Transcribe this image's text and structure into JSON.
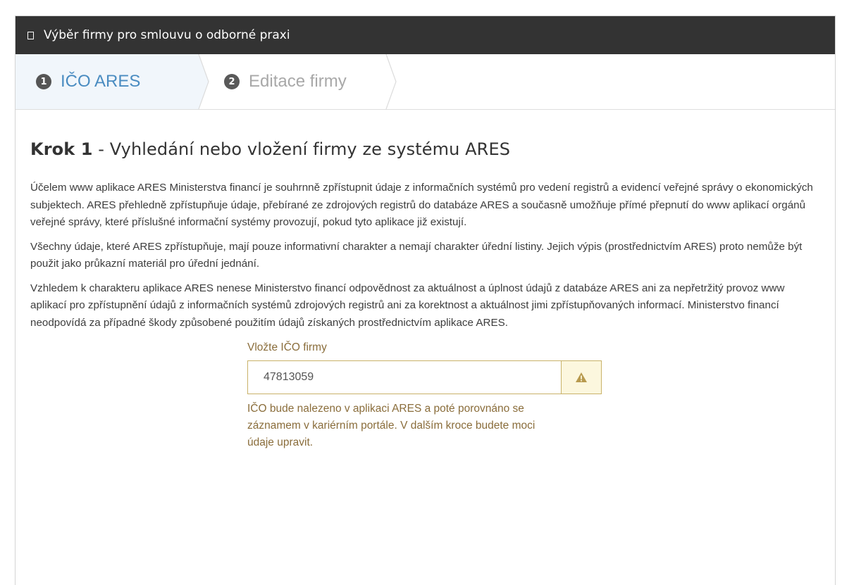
{
  "window": {
    "title": "Výběr firmy pro smlouvu o odborné praxi"
  },
  "wizard": {
    "steps": [
      {
        "number": "1",
        "label": "IČO ARES",
        "state": "active"
      },
      {
        "number": "2",
        "label": "Editace firmy",
        "state": "inactive"
      }
    ]
  },
  "main": {
    "heading_bold": "Krok 1",
    "heading_rest": " - Vyhledání nebo vložení firmy ze systému ARES",
    "paragraphs": [
      "Účelem www aplikace ARES Ministerstva financí je souhrnně zpřístupnit údaje z informačních systémů pro vedení registrů a evidencí veřejné správy o ekonomických subjektech. ARES přehledně zpřístupňuje údaje, přebírané ze zdrojových registrů do databáze ARES a současně umožňuje přímé přepnutí do www aplikací orgánů veřejné správy, které příslušné informační systémy provozují, pokud tyto aplikace již existují.",
      "Všechny údaje, které ARES zpřístupňuje, mají pouze informativní charakter a nemají charakter úřední listiny. Jejich výpis (prostřednictvím ARES) proto nemůže být použit jako průkazní materiál pro úřední jednání.",
      "Vzhledem k charakteru aplikace ARES nenese Ministerstvo financí odpovědnost za aktuálnost a úplnost údajů z databáze ARES ani za nepřetržitý provoz www aplikací pro zpřístupnění údajů z informačních systémů zdrojových registrů ani za korektnost a aktuálnost jimi zpřístupňovaných informací. Ministerstvo financí neodpovídá za případné škody způsobené použitím údajů získaných prostřednictvím aplikace ARES."
    ]
  },
  "form": {
    "label": "Vložte IČO firmy",
    "ico_value": "47813059",
    "addon_icon": "warning-icon",
    "help_text": "IČO bude nalezeno v aplikaci ARES a poté porovnáno se záznamem v kariérním portále. V dalším kroce budete moci údaje upravit."
  },
  "colors": {
    "titlebar_bg": "#333333",
    "active_step_text": "#4a8cc1",
    "active_step_bg": "#f1f6fb",
    "warning_text": "#8a6d3b",
    "warning_border": "#c9b269",
    "warning_addon_bg": "#fcf7de"
  }
}
